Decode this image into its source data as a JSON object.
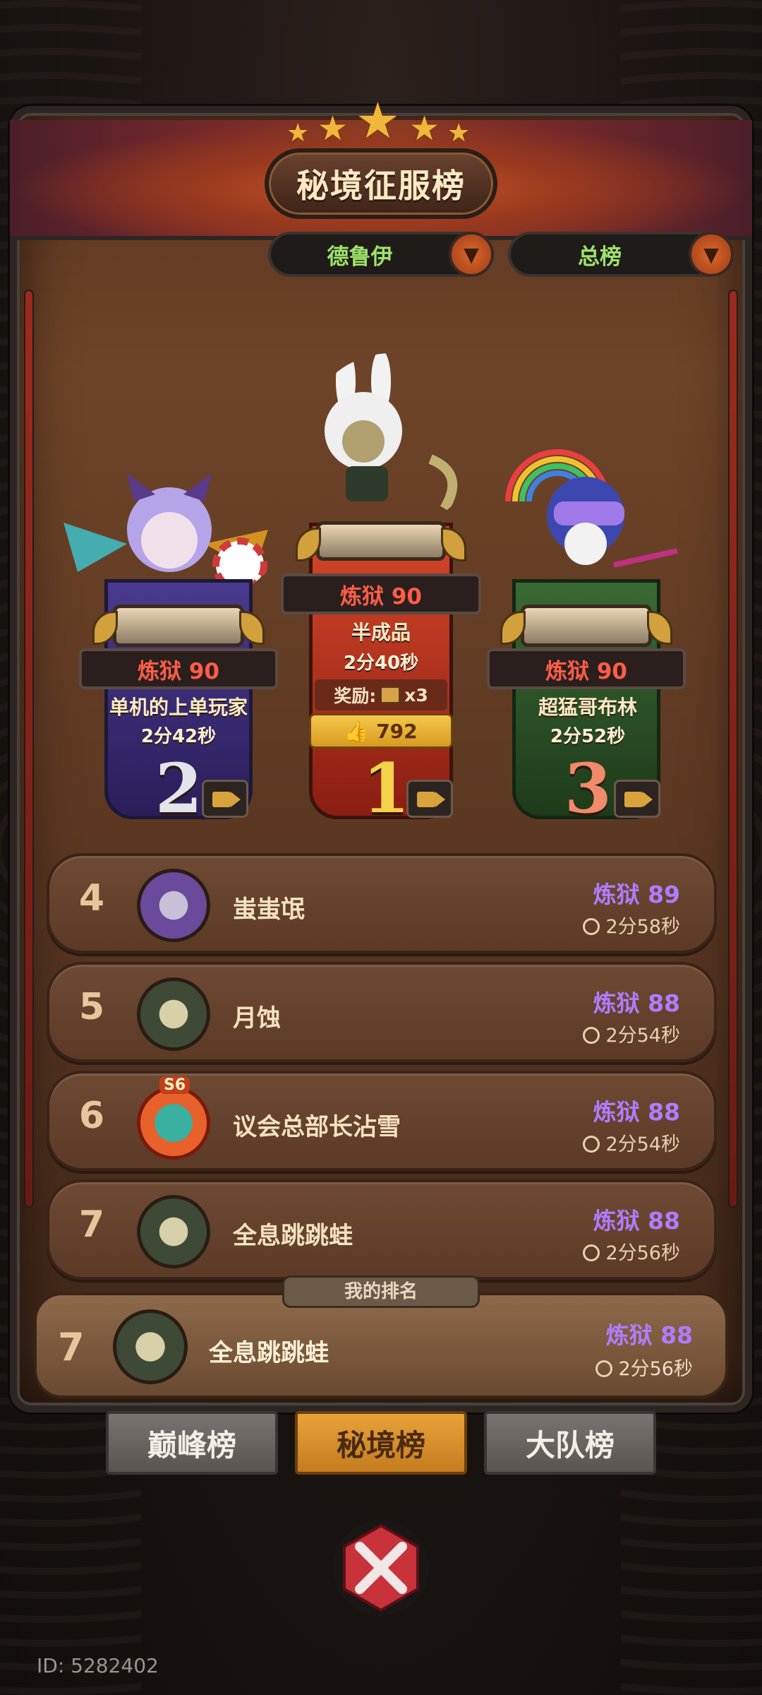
{
  "header": {
    "title": "秘境征服榜"
  },
  "filters": [
    {
      "label": "德鲁伊"
    },
    {
      "label": "总榜"
    }
  ],
  "podium": {
    "first": {
      "level": "炼狱 90",
      "name": "半成品",
      "time": "2分40秒",
      "reward_label": "奖励:",
      "reward_count": "x3",
      "likes": "792",
      "rank": "1"
    },
    "second": {
      "level": "炼狱 90",
      "name": "单机的上单玩家",
      "time": "2分42秒",
      "rank": "2"
    },
    "third": {
      "level": "炼狱 90",
      "name": "超猛哥布林",
      "time": "2分52秒",
      "rank": "3"
    }
  },
  "rows": [
    {
      "rank": "4",
      "name": "蚩蚩氓",
      "level": "炼狱 89",
      "time": "2分58秒"
    },
    {
      "rank": "5",
      "name": "月蚀",
      "level": "炼狱 88",
      "time": "2分54秒"
    },
    {
      "rank": "6",
      "name": "议会总部长沾雪",
      "level": "炼狱 88",
      "time": "2分54秒",
      "badge": "S6"
    },
    {
      "rank": "7",
      "name": "全息跳跳蛙",
      "level": "炼狱 88",
      "time": "2分56秒"
    }
  ],
  "my_rank": {
    "label": "我的排名",
    "rank": "7",
    "name": "全息跳跳蛙",
    "level": "炼狱 88",
    "time": "2分56秒"
  },
  "tabs": [
    {
      "label": "巅峰榜",
      "active": false
    },
    {
      "label": "秘境榜",
      "active": true
    },
    {
      "label": "大队榜",
      "active": false
    }
  ],
  "footer": {
    "id_text": "ID: 5282402"
  },
  "colors": {
    "level_red": "#ff5d48",
    "level_purple": "#b07cff",
    "filter_green": "#9de36a",
    "gold": "#f2b63a"
  },
  "icons": [
    "star-icon",
    "chevron-down-icon",
    "video-camera-icon",
    "thumbs-up-icon",
    "clock-icon",
    "chest-icon",
    "close-x-icon"
  ]
}
